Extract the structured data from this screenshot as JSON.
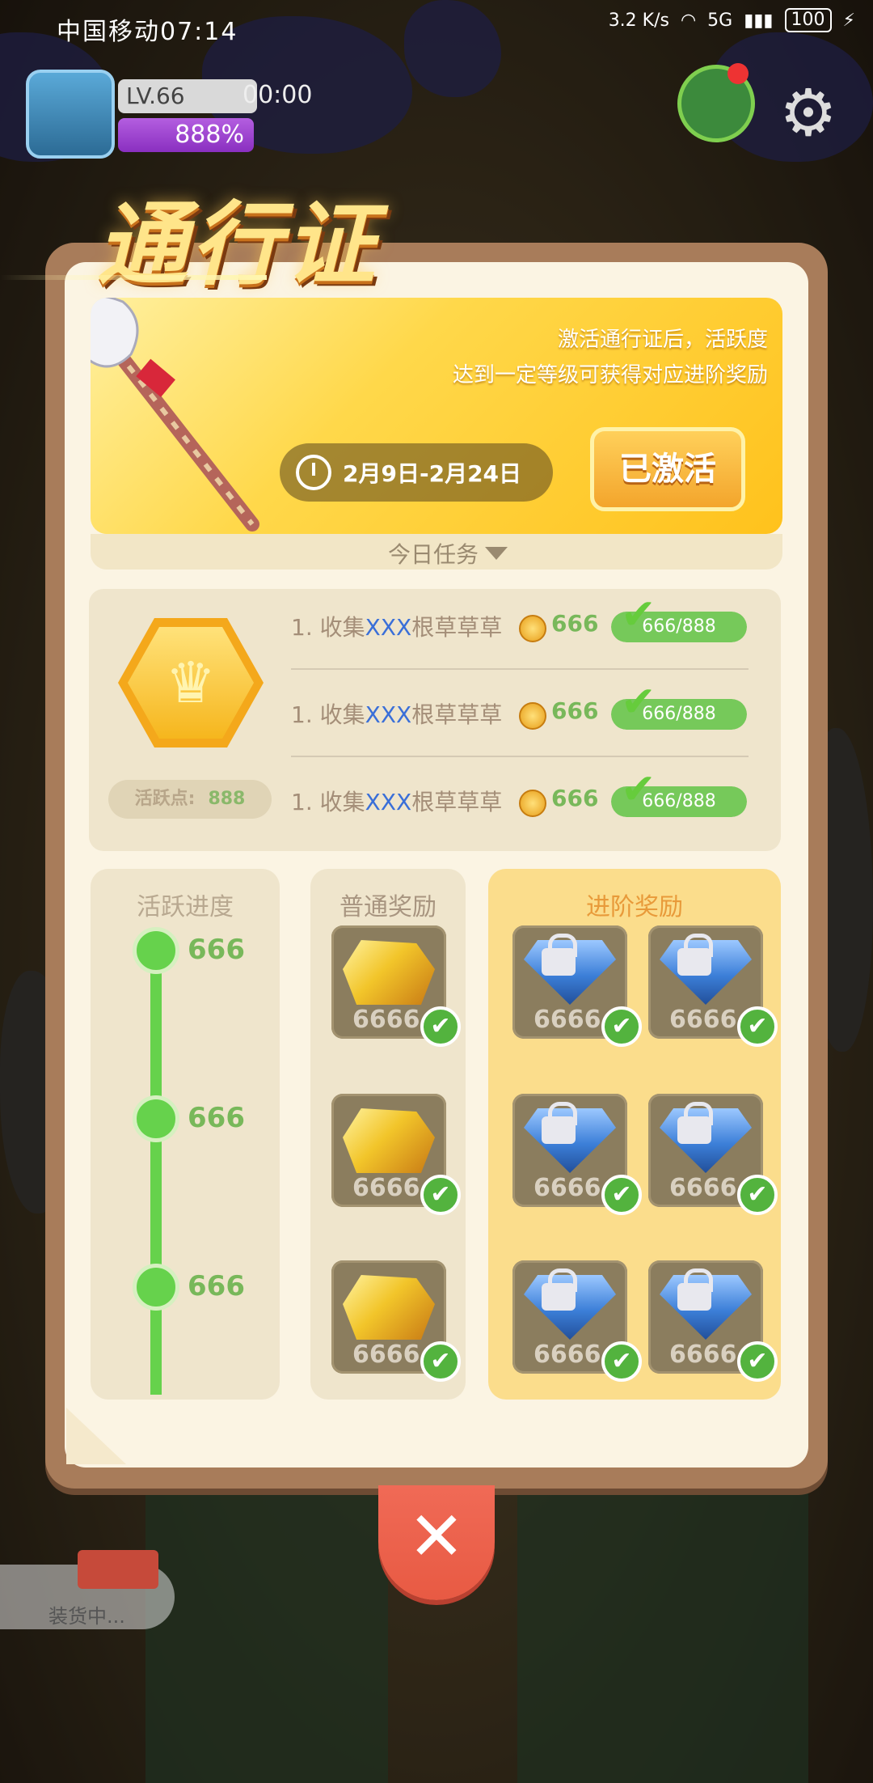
{
  "status_bar": {
    "carrier_time": "中国移动07:14",
    "speed": "3.2 K/s",
    "network": "5G",
    "battery": "100"
  },
  "hud": {
    "level": "LV.66",
    "timer": "00:00",
    "percent": "888%"
  },
  "title": "通行证",
  "banner": {
    "desc_line1": "激活通行证后，活跃度",
    "desc_line2": "达到一定等级可获得对应进阶奖励",
    "date_range": "2月9日-2月24日",
    "activated_label": "已激活",
    "today_tasks": "今日任务"
  },
  "tasks": {
    "activity_label": "活跃点:",
    "activity_value": "888",
    "items": [
      {
        "index": "1.",
        "prefix": "收集",
        "highlight": "XXX",
        "suffix": "根草草草",
        "reward": "666",
        "progress_text": "666/888",
        "progress": 1.0
      },
      {
        "index": "1.",
        "prefix": "收集",
        "highlight": "XXX",
        "suffix": "根草草草",
        "reward": "666",
        "progress_text": "666/888",
        "progress": 1.0
      },
      {
        "index": "1.",
        "prefix": "收集",
        "highlight": "XXX",
        "suffix": "根草草草",
        "reward": "666",
        "progress_text": "666/888",
        "progress": 1.0
      }
    ]
  },
  "columns": {
    "progress_title": "活跃进度",
    "normal_title": "普通奖励",
    "advanced_title": "进阶奖励",
    "milestones": [
      "666",
      "666",
      "666"
    ],
    "normal_rewards": [
      {
        "icon": "gold-ore-icon",
        "amount": "6666"
      },
      {
        "icon": "gold-ore-icon",
        "amount": "6666"
      },
      {
        "icon": "gold-ore-icon",
        "amount": "6666"
      }
    ],
    "advanced_rewards": [
      [
        {
          "icon": "locked-diamond-icon",
          "amount": "6666"
        },
        {
          "icon": "locked-diamond-icon",
          "amount": "6666"
        }
      ],
      [
        {
          "icon": "locked-diamond-icon",
          "amount": "6666"
        },
        {
          "icon": "locked-diamond-icon",
          "amount": "6666"
        }
      ],
      [
        {
          "icon": "locked-diamond-icon",
          "amount": "6666"
        },
        {
          "icon": "locked-diamond-icon",
          "amount": "6666"
        }
      ]
    ]
  },
  "close_icon": "✕",
  "loading_label": "装货中..."
}
